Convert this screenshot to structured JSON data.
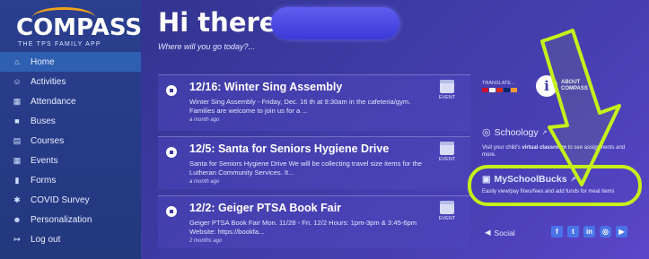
{
  "logo": {
    "title": "COMPASS",
    "subtitle": "THE TPS FAMILY APP"
  },
  "sidebar": {
    "items": [
      {
        "label": "Home",
        "icon": "home-icon",
        "glyph": "⌂",
        "active": true
      },
      {
        "label": "Activities",
        "icon": "activities-icon",
        "glyph": "☺",
        "active": false
      },
      {
        "label": "Attendance",
        "icon": "attendance-icon",
        "glyph": "▦",
        "active": false
      },
      {
        "label": "Buses",
        "icon": "bus-icon",
        "glyph": "■",
        "active": false
      },
      {
        "label": "Courses",
        "icon": "courses-icon",
        "glyph": "▤",
        "active": false
      },
      {
        "label": "Events",
        "icon": "events-icon",
        "glyph": "▦",
        "active": false
      },
      {
        "label": "Forms",
        "icon": "forms-icon",
        "glyph": "▮",
        "active": false
      },
      {
        "label": "COVID Survey",
        "icon": "covid-icon",
        "glyph": "✱",
        "active": false
      },
      {
        "label": "Personalization",
        "icon": "person-icon",
        "glyph": "☻",
        "active": false
      },
      {
        "label": "Log out",
        "icon": "logout-icon",
        "glyph": "↦",
        "active": false
      }
    ]
  },
  "header": {
    "greeting": "Hi there,",
    "subtitle": "Where will you go today?..."
  },
  "feed": [
    {
      "title": "12/16: Winter Sing Assembly",
      "desc": "Winter Sing Assembly - Friday, Dec. 16 th at 9:30am in the cafeteria/gym. Families are welcome to join us for a ...",
      "time": "a month ago",
      "tag": "EVENT"
    },
    {
      "title": "12/5: Santa for Seniors Hygiene Drive",
      "desc": "Santa for Seniors Hygiene Drive We will be collecting travel size items for the Lutheran Community Services. It...",
      "time": "a month ago",
      "tag": "EVENT"
    },
    {
      "title": "12/2: Geiger PTSA Book Fair",
      "desc": "Geiger PTSA Book Fair Mon. 11/28 - Fri. 12/2 Hours: 1pm-3pm & 3:45-6pm Website: https://bookfa...",
      "time": "2 months ago",
      "tag": "EVENT"
    }
  ],
  "right": {
    "translate": "TRANSLATE...",
    "about": "ABOUT\nCOMPASS",
    "schoology_title": "Schoology",
    "schoology_desc_a": "Visit your child's ",
    "schoology_desc_b": "virtual classroom",
    "schoology_desc_c": " to see assignments and more.",
    "msb_title": "MySchoolBucks",
    "msb_desc": "Easily view/pay fines/fees and add funds for meal items",
    "social_label": "Social",
    "social_icons": [
      "facebook-icon",
      "twitter-icon",
      "linkedin-icon",
      "instagram-icon",
      "youtube-icon"
    ]
  },
  "colors": {
    "highlight": "#c6f01a",
    "sidebar_active": "#2f5fb0"
  }
}
